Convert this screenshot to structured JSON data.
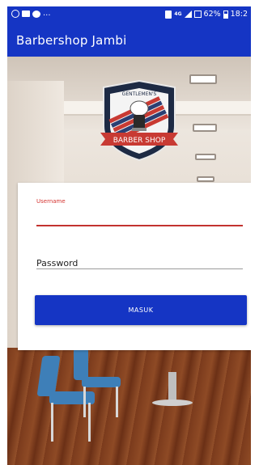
{
  "status_bar": {
    "left_icons": [
      "whatsapp-icon",
      "message-icon",
      "chat-icon"
    ],
    "left_more": "...",
    "network": "4G",
    "battery_percent": "62%",
    "time": "18:2"
  },
  "app_bar": {
    "title": "Barbershop Jambi"
  },
  "logo": {
    "top_text": "GENTLEMEN'S",
    "ribbon_text": "BARBER SHOP"
  },
  "login": {
    "username_label": "Username",
    "username_value": "",
    "password_placeholder": "Password",
    "submit_label": "MASUK"
  },
  "colors": {
    "primary": "#1535c4",
    "accent": "#c3332f",
    "card": "#ffffff"
  }
}
